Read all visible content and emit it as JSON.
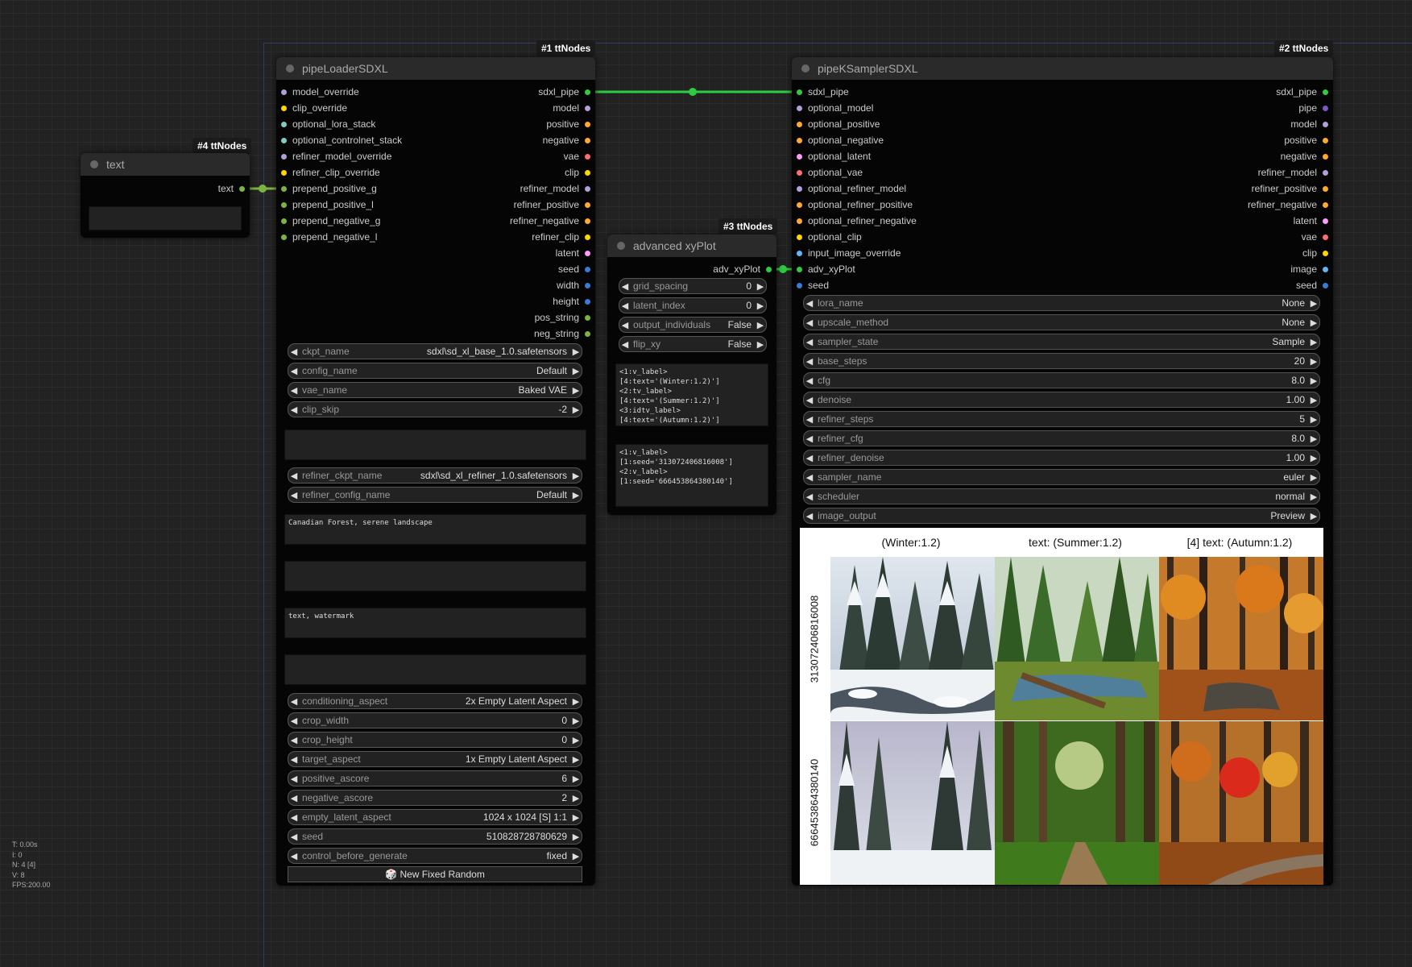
{
  "stats": {
    "t": "T: 0.00s",
    "i": "I: 0",
    "n": "N: 4 [4]",
    "v": "V: 8",
    "fps": "FPS:200.00"
  },
  "badges": {
    "n1": "#1 ttNodes",
    "n2": "#2 ttNodes",
    "n3": "#3 ttNodes",
    "n4": "#4 ttNodes"
  },
  "text_node": {
    "title": "text",
    "output": "text"
  },
  "loader": {
    "title": "pipeLoaderSDXL",
    "inputs": [
      "model_override",
      "clip_override",
      "optional_lora_stack",
      "optional_controlnet_stack",
      "refiner_model_override",
      "refiner_clip_override",
      "prepend_positive_g",
      "prepend_positive_l",
      "prepend_negative_g",
      "prepend_negative_l"
    ],
    "input_colors": [
      "#b39ddb",
      "#ffd500",
      "#80cbc4",
      "#80cbc4",
      "#b39ddb",
      "#ffd500",
      "#7cb342",
      "#7cb342",
      "#7cb342",
      "#7cb342"
    ],
    "outputs": [
      "sdxl_pipe",
      "model",
      "positive",
      "negative",
      "vae",
      "clip",
      "refiner_model",
      "refiner_positive",
      "refiner_negative",
      "refiner_clip",
      "latent",
      "seed",
      "width",
      "height",
      "pos_string",
      "neg_string"
    ],
    "output_colors": [
      "#2ecc40",
      "#b39ddb",
      "#ffa931",
      "#ffa931",
      "#ff6e6e",
      "#ffd500",
      "#b39ddb",
      "#ffa931",
      "#ffa931",
      "#ffd500",
      "#ff9cf9",
      "#3a7bd5",
      "#3a7bd5",
      "#3a7bd5",
      "#7cb342",
      "#7cb342"
    ],
    "widgets_a": [
      [
        "ckpt_name",
        "sdxl\\sd_xl_base_1.0.safetensors"
      ],
      [
        "config_name",
        "Default"
      ],
      [
        "vae_name",
        "Baked VAE"
      ],
      [
        "clip_skip",
        "-2"
      ]
    ],
    "widgets_b": [
      [
        "refiner_ckpt_name",
        "sdxl\\sd_xl_refiner_1.0.safetensors"
      ],
      [
        "refiner_config_name",
        "Default"
      ]
    ],
    "positive_text": "Canadian Forest, serene landscape",
    "negative_text": "text, watermark",
    "widgets_c": [
      [
        "conditioning_aspect",
        "2x Empty Latent Aspect"
      ],
      [
        "crop_width",
        "0"
      ],
      [
        "crop_height",
        "0"
      ],
      [
        "target_aspect",
        "1x Empty Latent Aspect"
      ],
      [
        "positive_ascore",
        "6"
      ],
      [
        "negative_ascore",
        "2"
      ],
      [
        "empty_latent_aspect",
        "1024 x 1024 [S] 1:1"
      ],
      [
        "seed",
        "510828728780629"
      ],
      [
        "control_before_generate",
        "fixed"
      ]
    ],
    "button_label": "🎲 New Fixed Random"
  },
  "xy": {
    "title": "advanced xyPlot",
    "output": "adv_xyPlot",
    "widgets": [
      [
        "grid_spacing",
        "0"
      ],
      [
        "latent_index",
        "0"
      ],
      [
        "output_individuals",
        "False"
      ],
      [
        "flip_xy",
        "False"
      ]
    ],
    "x_text": "<1:v_label>\n[4:text='(Winter:1.2)']\n<2:tv_label>\n[4:text='(Summer:1.2)']\n<3:idtv_label>\n[4:text='(Autumn:1.2)']",
    "y_text": "<1:v_label>\n[1:seed='313072406816008']\n<2:v_label>\n[1:seed='666453864380140']"
  },
  "sampler": {
    "title": "pipeKSamplerSDXL",
    "inputs": [
      "sdxl_pipe",
      "optional_model",
      "optional_positive",
      "optional_negative",
      "optional_latent",
      "optional_vae",
      "optional_refiner_model",
      "optional_refiner_positive",
      "optional_refiner_negative",
      "optional_clip",
      "input_image_override",
      "adv_xyPlot",
      "seed"
    ],
    "input_colors": [
      "#2ecc40",
      "#b39ddb",
      "#ffa931",
      "#ffa931",
      "#ff9cf9",
      "#ff6e6e",
      "#b39ddb",
      "#ffa931",
      "#ffa931",
      "#ffd500",
      "#64b5f6",
      "#2ecc40",
      "#3a7bd5"
    ],
    "outputs": [
      "sdxl_pipe",
      "pipe",
      "model",
      "positive",
      "negative",
      "refiner_model",
      "refiner_positive",
      "refiner_negative",
      "latent",
      "vae",
      "clip",
      "image",
      "seed"
    ],
    "output_colors": [
      "#2ecc40",
      "#7e57c2",
      "#b39ddb",
      "#ffa931",
      "#ffa931",
      "#b39ddb",
      "#ffa931",
      "#ffa931",
      "#ff9cf9",
      "#ff6e6e",
      "#ffd500",
      "#64b5f6",
      "#3a7bd5"
    ],
    "widgets": [
      [
        "lora_name",
        "None"
      ],
      [
        "upscale_method",
        "None"
      ],
      [
        "sampler_state",
        "Sample"
      ],
      [
        "base_steps",
        "20"
      ],
      [
        "cfg",
        "8.0"
      ],
      [
        "denoise",
        "1.00"
      ],
      [
        "refiner_steps",
        "5"
      ],
      [
        "refiner_cfg",
        "8.0"
      ],
      [
        "refiner_denoise",
        "1.00"
      ],
      [
        "sampler_name",
        "euler"
      ],
      [
        "scheduler",
        "normal"
      ],
      [
        "image_output",
        "Preview"
      ]
    ]
  },
  "plot": {
    "columns": [
      "(Winter:1.2)",
      "text: (Summer:1.2)",
      "[4] text: (Autumn:1.2)"
    ],
    "rows": [
      "313072406816008",
      "666453864380140"
    ]
  }
}
